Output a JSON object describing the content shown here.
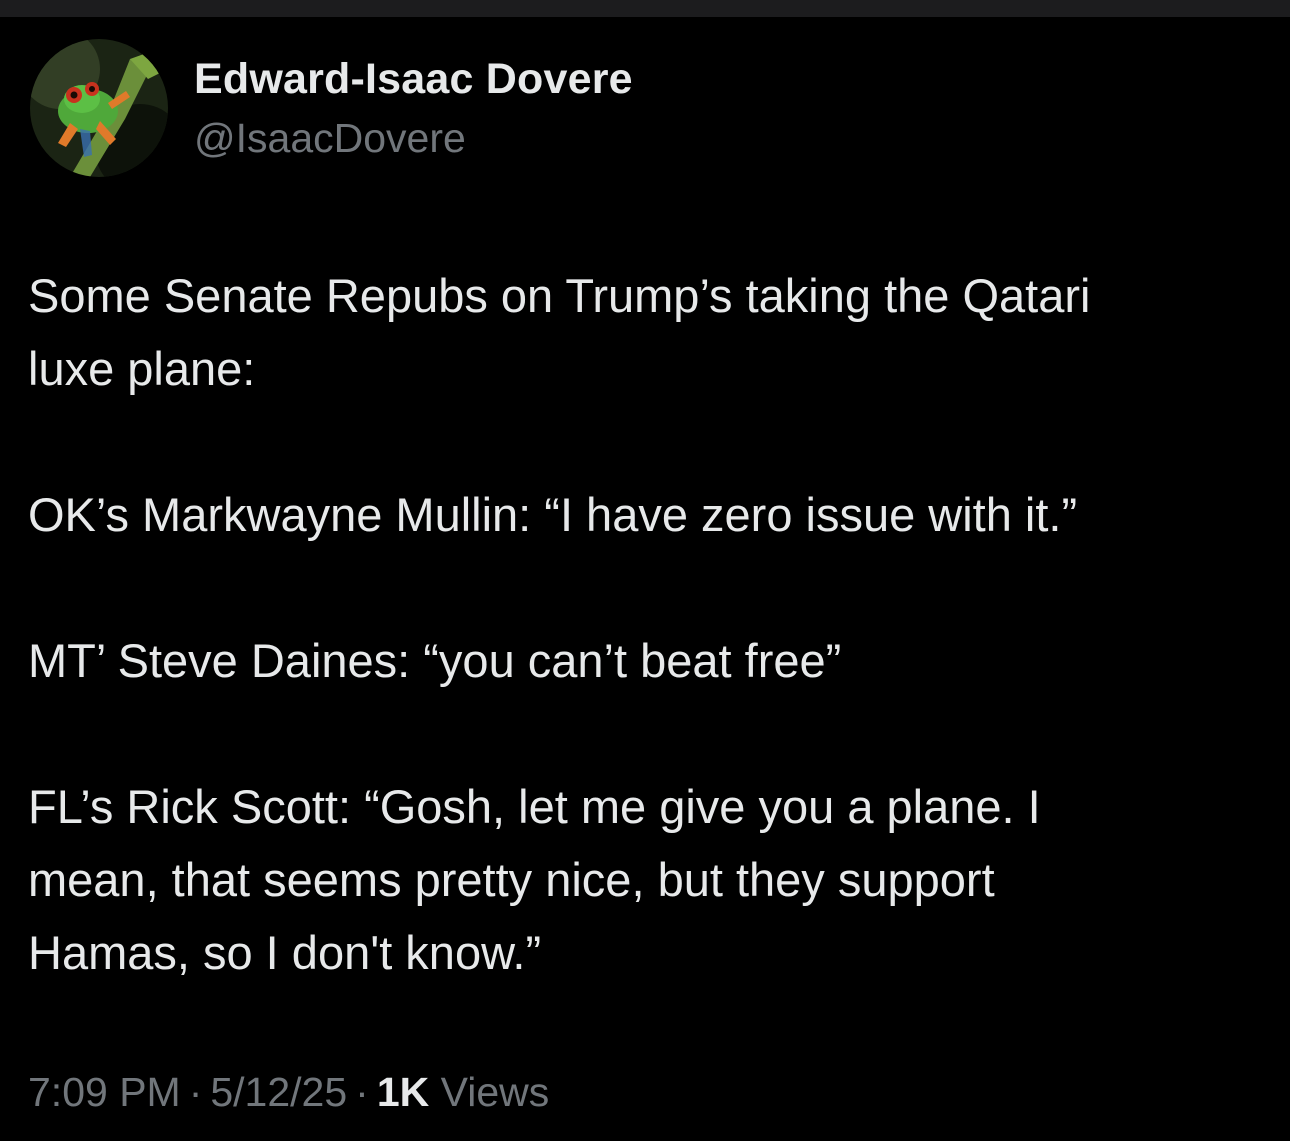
{
  "author": {
    "display_name": "Edward-Isaac Dovere",
    "handle": "@IsaacDovere",
    "avatar_icon": "tree-frog-avatar"
  },
  "tweet": {
    "paragraphs": [
      "Some Senate Repubs on Trump’s taking the Qatari\nluxe plane:",
      "OK’s Markwayne Mullin: “I have zero issue with it.”",
      "MT’ Steve Daines: “you can’t beat free”",
      "FL’s Rick Scott: “Gosh, let me give you a plane. I\nmean, that seems pretty nice, but they support\nHamas, so I don't know.”"
    ],
    "time": "7:09 PM",
    "date": "5/12/25",
    "separator": "·",
    "views_count": "1K",
    "views_label": "Views"
  },
  "colors": {
    "background": "#000000",
    "primary_text": "#e7e9ea",
    "secondary_text": "#71767b"
  }
}
